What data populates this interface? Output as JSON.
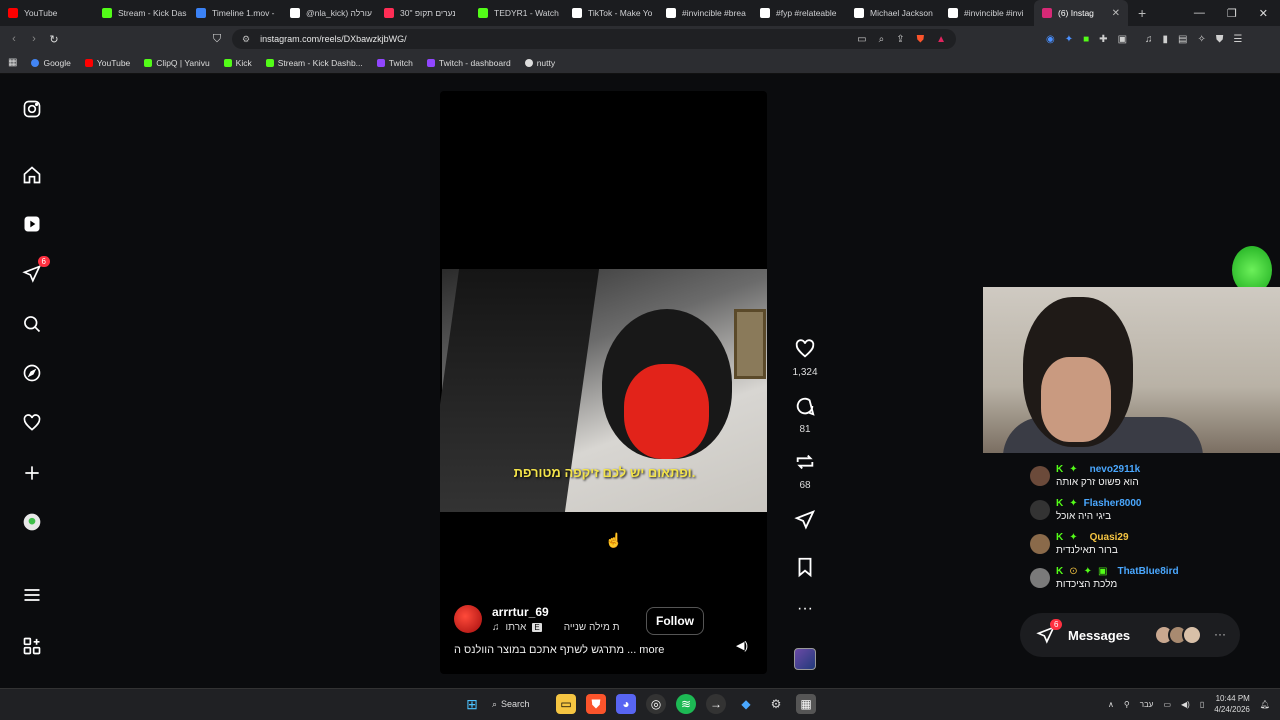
{
  "tabs": [
    {
      "title": "YouTube",
      "color": "#ff0000"
    },
    {
      "title": "Stream - Kick Das",
      "color": "#53fc18"
    },
    {
      "title": "Timeline 1.mov -",
      "color": "#3b82f6"
    },
    {
      "title": "@nla_kick) עורלה",
      "color": "#ffffff"
    },
    {
      "title": "30\" נערים תקופ",
      "color": "#ff2d55"
    },
    {
      "title": "TEDYR1 - Watch",
      "color": "#53fc18"
    },
    {
      "title": "TikTok - Make Yo",
      "color": "#ffffff"
    },
    {
      "title": "#invincible #brea",
      "color": "#ffffff"
    },
    {
      "title": "#fyp #relateable",
      "color": "#ffffff"
    },
    {
      "title": "Michael Jackson",
      "color": "#ffffff"
    },
    {
      "title": "#invincible #invi",
      "color": "#ffffff"
    },
    {
      "title": "(6) Instag",
      "color": "#d62976",
      "active": true
    }
  ],
  "address": {
    "url": "instagram.com/reels/DXbawzkjbWG/"
  },
  "bookmarks": [
    {
      "label": "Google",
      "color": "#4285f4"
    },
    {
      "label": "YouTube",
      "color": "#ff0000"
    },
    {
      "label": "ClipQ | Yanivu",
      "color": "#53fc18"
    },
    {
      "label": "Kick",
      "color": "#53fc18"
    },
    {
      "label": "Stream - Kick Dashb...",
      "color": "#53fc18"
    },
    {
      "label": "Twitch",
      "color": "#9146ff"
    },
    {
      "label": "Twitch - dashboard",
      "color": "#9146ff"
    },
    {
      "label": "nutty",
      "color": "#dddddd"
    }
  ],
  "sidebar": {
    "notifications_badge": "6"
  },
  "reel": {
    "subtitle": "ופתאום יש לכם זיקפה מטורפת.",
    "username": "arrrtur_69",
    "audio_explicit": "E",
    "audio_primary": "ארתו",
    "audio_secondary": "ת מילה שנייה",
    "follow_label": "Follow",
    "caption": "מתרגש לשתף אתכם במוצר הוולנס ה ... more"
  },
  "actions": {
    "likes": "1,324",
    "comments": "81",
    "reposts": "68"
  },
  "chat": [
    {
      "name": "nevo2911k",
      "color": "#4aa8ff",
      "text": "הוא פשוט זרק אותה",
      "extra_badge": false
    },
    {
      "name": "Flasher8000",
      "color": "#4aa8ff",
      "text": "ביגי היה אוכל",
      "extra_badge": false
    },
    {
      "name": "Quasi29",
      "color": "#f5c542",
      "text": "ברור תאילנדית",
      "extra_badge": false
    },
    {
      "name": "ThatBlue8ird",
      "color": "#4aa8ff",
      "text": "מלכת הציכדות",
      "extra_badge": true
    }
  ],
  "messages": {
    "label": "Messages",
    "badge": "6"
  },
  "taskbar": {
    "search_label": "Search",
    "lang": "עבר",
    "time": "10:44 PM",
    "date": "4/24/2026"
  }
}
